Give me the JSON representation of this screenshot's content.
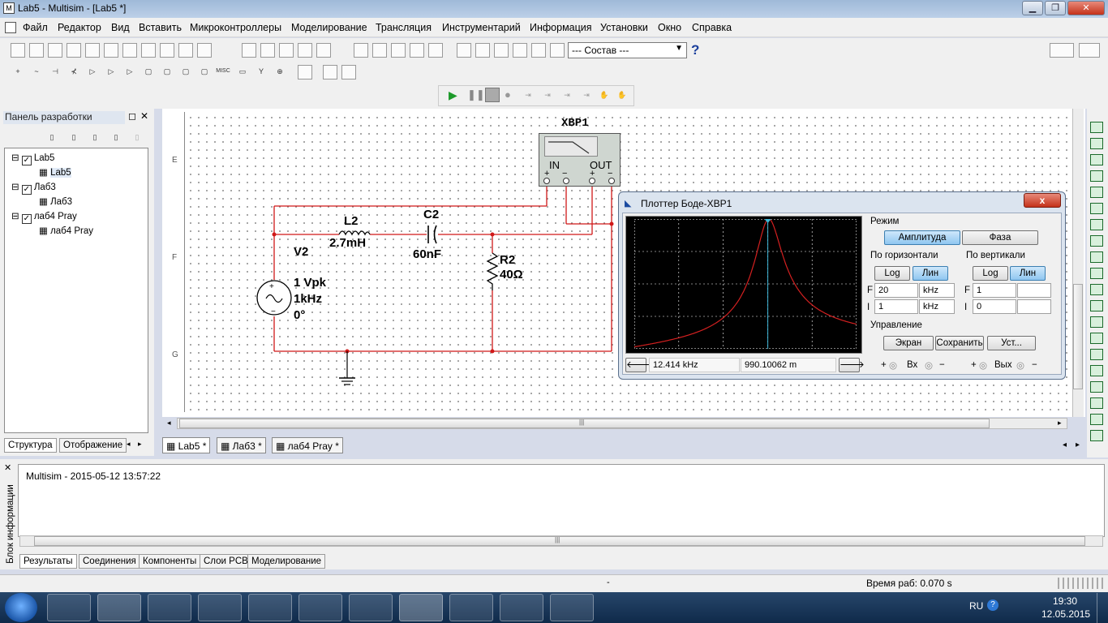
{
  "window": {
    "title": "Lab5 - Multisim - [Lab5 *]",
    "minimize": "▁",
    "maximize": "❐",
    "close": "✕"
  },
  "menu": [
    "Файл",
    "Редактор",
    "Вид",
    "Вставить",
    "Микроконтроллеры",
    "Моделирование",
    "Трансляция",
    "Инструментарий",
    "Информация",
    "Установки",
    "Окно",
    "Справка"
  ],
  "toolbar": {
    "combo_value": "--- Состав ---",
    "help": "?"
  },
  "design_panel": {
    "title": "Панель разработки",
    "close": "✕",
    "tree": [
      {
        "label": "Lab5",
        "child": "Lab5"
      },
      {
        "label": "Лаб3",
        "child": "Лаб3"
      },
      {
        "label": "лаб4 Pray",
        "child": "лаб4 Pray"
      }
    ],
    "tabs": [
      "Структура",
      "Отображение"
    ]
  },
  "workspace": {
    "row_labels": [
      "E",
      "F",
      "G"
    ],
    "tabs": [
      "Lab5 *",
      "Лаб3 *",
      "лаб4 Pray *"
    ],
    "scroll_grip": "|||"
  },
  "circuit": {
    "instrument": {
      "name": "XBP1",
      "in": "IN",
      "out": "OUT",
      "plus": "+",
      "minus": "−"
    },
    "source": {
      "name": "V2",
      "amp": "1 Vpk",
      "freq": "1kHz",
      "phase": "0°"
    },
    "inductor": {
      "name": "L2",
      "value": "2.7mH"
    },
    "capacitor": {
      "name": "C2",
      "value": "60nF"
    },
    "resistor": {
      "name": "R2",
      "value": "40Ω"
    }
  },
  "bode": {
    "title": "Плоттер Боде-XBP1",
    "close": "x",
    "mode_label": "Режим",
    "mode_buttons": [
      "Амплитуда",
      "Фаза"
    ],
    "horizontal": {
      "label": "По горизонтали",
      "buttons": [
        "Log",
        "Лин"
      ],
      "F": {
        "letter": "F",
        "value": "20",
        "unit": "kHz"
      },
      "I": {
        "letter": "I",
        "value": "1",
        "unit": "kHz"
      }
    },
    "vertical": {
      "label": "По вертикали",
      "buttons": [
        "Log",
        "Лин"
      ],
      "F": {
        "letter": "F",
        "value": "1",
        "unit": ""
      },
      "I": {
        "letter": "I",
        "value": "0",
        "unit": ""
      }
    },
    "control_label": "Управление",
    "control_buttons": [
      "Экран",
      "Сохранить",
      "Уст..."
    ],
    "readout": {
      "freq": "12.414 kHz",
      "value": "990.10062 m"
    },
    "io": {
      "in": "Вх",
      "out": "Вых",
      "plus": "+",
      "minus": "−"
    },
    "curve_color": "#d42020"
  },
  "info": {
    "side_label": "Блок информации",
    "message": "Multisim  -  2015-05-12 13:57:22",
    "tabs": [
      "Результаты",
      "Соединения",
      "Компоненты",
      "Слои PCB",
      "Моделирование"
    ],
    "scroll_grip": "|||"
  },
  "status": {
    "dot": "-",
    "runtime": "Время раб: 0.070 s"
  },
  "taskbar": {
    "lang": "RU",
    "time": "19:30",
    "date": "12.05.2015"
  }
}
